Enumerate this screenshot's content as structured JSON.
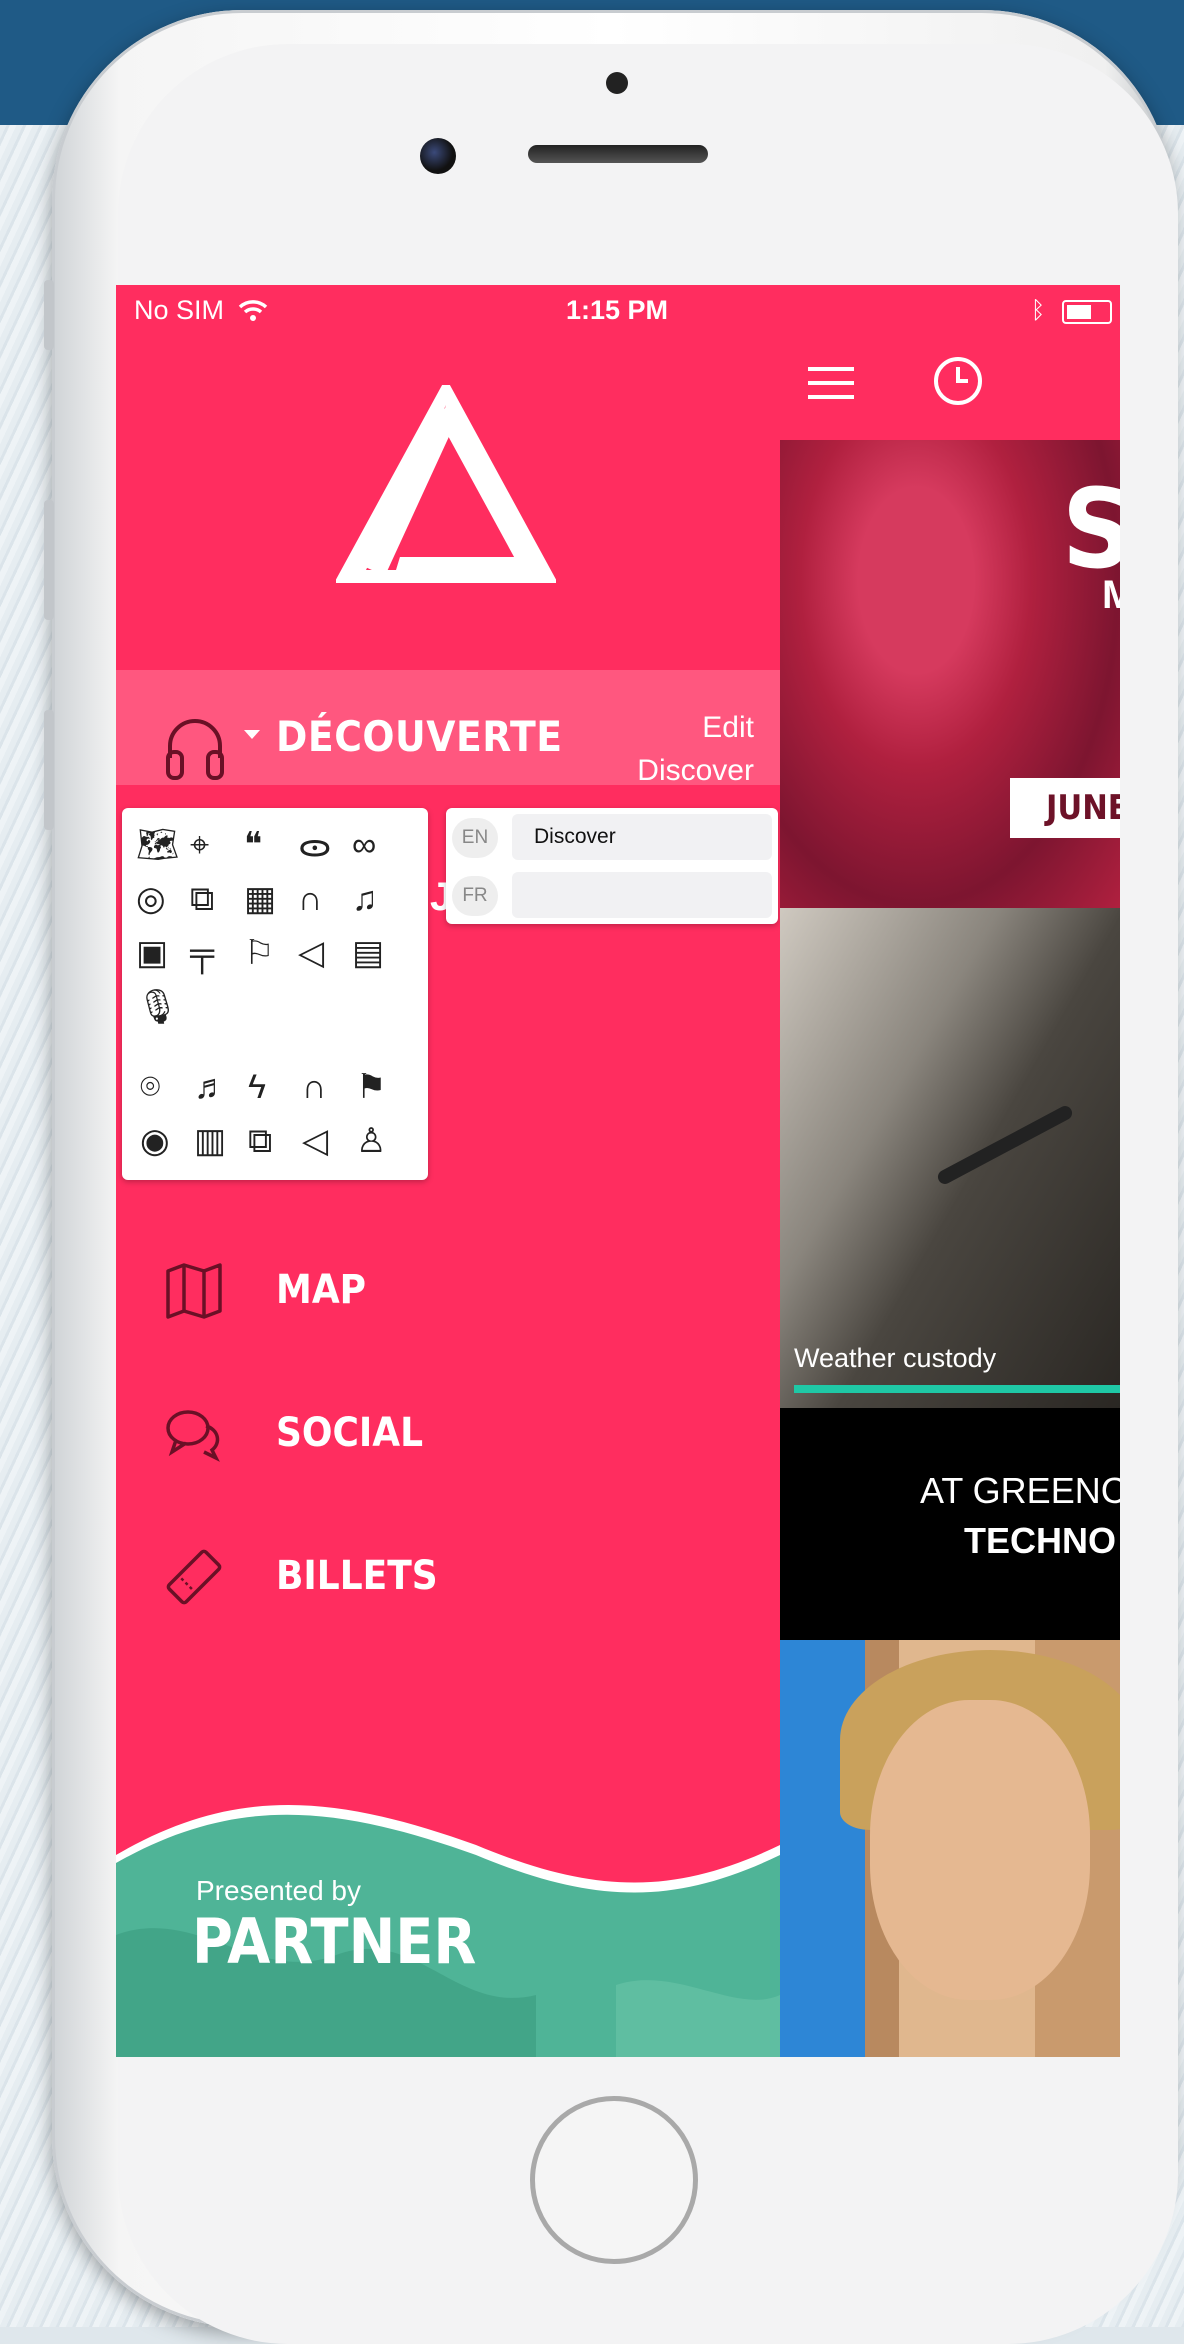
{
  "status_bar": {
    "carrier": "No SIM",
    "time": "1:15 PM"
  },
  "drawer": {
    "section": {
      "title": "DÉCOUVERTE",
      "edit_label": "Edit",
      "edit_value": "Discover"
    },
    "languages": [
      {
        "code": "EN",
        "value": "Discover"
      },
      {
        "code": "FR",
        "value": ""
      }
    ],
    "menu": [
      {
        "label": "MAP",
        "icon": "map-icon"
      },
      {
        "label": "SOCIAL",
        "icon": "chat-icon"
      },
      {
        "label": "BILLETS",
        "icon": "ticket-icon"
      }
    ],
    "partner": {
      "presented_by": "Presented by",
      "name": "PARTNER"
    },
    "accent_color": "#ff2d5f",
    "partner_color": "#4fb497"
  },
  "main": {
    "card1": {
      "letter": "S",
      "subletter": "M",
      "band": "JUNE"
    },
    "card2": {
      "caption": "Weather custody"
    },
    "card3": {
      "line1": "AT GREENC",
      "line2": "TECHNO"
    }
  }
}
